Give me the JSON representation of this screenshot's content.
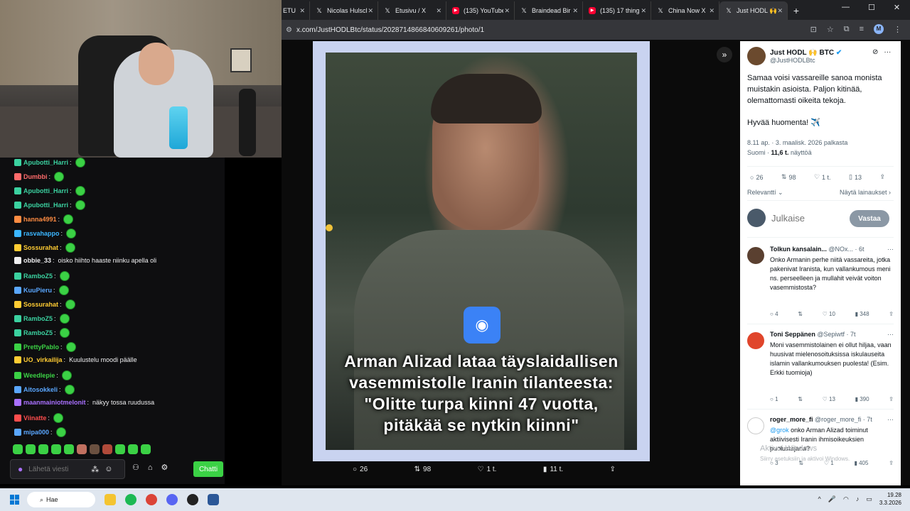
{
  "chat": {
    "messages": [
      {
        "user": "Apubotti_Harri",
        "color": "#3bd1a0",
        "text": ""
      },
      {
        "user": "Dumbbi",
        "color": "#ff6b6b",
        "text": ""
      },
      {
        "user": "Apubotti_Harri",
        "color": "#3bd1a0",
        "text": ""
      },
      {
        "user": "Apubotti_Harri",
        "color": "#3bd1a0",
        "text": ""
      },
      {
        "user": "hanna4991",
        "color": "#ff8c42",
        "text": ""
      },
      {
        "user": "rasvahappo",
        "color": "#3bb6ff",
        "text": ""
      },
      {
        "user": "Sossurahat",
        "color": "#ffcc33",
        "text": ""
      },
      {
        "user": "obbie_33",
        "color": "#efeff1",
        "text": "oisko hiihto haaste niinku apella oli"
      },
      {
        "user": "RamboZ5",
        "color": "#3bd1a0",
        "text": ""
      },
      {
        "user": "KuuPieru",
        "color": "#5aa7ff",
        "text": ""
      },
      {
        "user": "Sossurahat",
        "color": "#ffcc33",
        "text": ""
      },
      {
        "user": "RamboZ5",
        "color": "#3bd1a0",
        "text": ""
      },
      {
        "user": "RamboZ5",
        "color": "#3bd1a0",
        "text": ""
      },
      {
        "user": "PrettyPablo",
        "color": "#3bd145",
        "text": ""
      },
      {
        "user": "UO_virkailija",
        "color": "#ffcc33",
        "text": "Kuulustelu moodi päälle"
      },
      {
        "user": "Weedlepie",
        "color": "#3bd145",
        "text": ""
      },
      {
        "user": "Aitosokkeli",
        "color": "#5aa7ff",
        "text": ""
      },
      {
        "user": "maanmainiotmelonit",
        "color": "#a970ff",
        "text": "näkyy tossa ruudussa"
      },
      {
        "user": "Viinatte",
        "color": "#ff4d4d",
        "text": ""
      },
      {
        "user": "mipa000",
        "color": "#5aa7ff",
        "text": ""
      }
    ],
    "input_placeholder": "Lähetä viesti",
    "send_label": "Chatti"
  },
  "browser": {
    "tabs": [
      {
        "label": "ETU",
        "icon": "x-icon"
      },
      {
        "label": "Nicolas Hulsch",
        "icon": "x-icon"
      },
      {
        "label": "Etusivu / X",
        "icon": "x-icon"
      },
      {
        "label": "(135) YouTube",
        "icon": "youtube-icon"
      },
      {
        "label": "Braindead Bir",
        "icon": "x-icon"
      },
      {
        "label": "(135) 17 thing",
        "icon": "youtube-icon"
      },
      {
        "label": "China Now X",
        "icon": "x-icon"
      },
      {
        "label": "Just HODL 🙌",
        "icon": "x-icon"
      }
    ],
    "url": "x.com/JustHODLBtc/status/2028714866840609261/photo/1",
    "profile_initial": "M"
  },
  "photo": {
    "caption_lines": [
      "Arman Alizad lataa täyslaidallisen",
      "vasemmistolle Iranin tilanteesta:",
      "\"Olitte turpa kiinni 47 vuotta,",
      "pitäkää se nytkin kiinni\""
    ],
    "actions": {
      "replies": "26",
      "reposts": "98",
      "likes": "1 t.",
      "views": "11 t."
    }
  },
  "tweet": {
    "name": "Just HODL 🙌 BTC",
    "handle": "@JustHODLBtc",
    "text": "Samaa voisi vassareille sanoa monista muistakin asioista. Paljon kitinää, olemattomasti oikeita tekoja.",
    "greeting": "Hyvää huomenta! ✈️",
    "meta_line1": "8.11 ap. · 3. maalisk. 2026 palkasta",
    "meta_lang": "Suomi · ",
    "meta_views": "11,6 t.",
    "meta_views_suffix": " näyttöä",
    "stats": {
      "replies": "26",
      "reposts": "98",
      "likes": "1 t.",
      "bookmarks": "13"
    },
    "sort_label": "Relevanttí",
    "quotes_label": "Näytä lainaukset",
    "reply_placeholder": "Julkaise",
    "reply_button": "Vastaa"
  },
  "replies": [
    {
      "name": "Tolkun kansalain...",
      "handle": "@NOx...",
      "time": "· 6t",
      "text": "Onko Armanin perhe niitä vassareita, jotka pakenivat Iranista, kun vallankumous meni ns. perseelleen ja mullahit veivät voiton vasemmistosta?",
      "stats": [
        "4",
        "",
        "10",
        "348"
      ]
    },
    {
      "name": "Toni Seppänen",
      "handle": "@Sepiwtf",
      "time": "· 7t",
      "text": "Moni vasemmistolainen ei ollut hiljaa, vaan huusivat mielenosoituksissa iskulauseita islamin vallankumouksen puolesta! (Esim. Erkki tuomioja)",
      "stats": [
        "1",
        "",
        "13",
        "390"
      ]
    },
    {
      "name": "roger_more_fi",
      "handle": "@roger_more_fi",
      "time": "· 7t",
      "mention": "@grok",
      "text": " onko Arman Alizad toiminut aktiivisesti Iranin ihmisoikeuksien puolustajana?",
      "stats": [
        "3",
        "",
        "1",
        "405"
      ]
    }
  ],
  "watermark": {
    "line1": "Aktivoi Windows",
    "line2": "Siirry asetuksiin ja aktivoi Windows."
  },
  "taskbar": {
    "search_label": "Hae",
    "time": "19.28",
    "date": "3.3.2026"
  }
}
